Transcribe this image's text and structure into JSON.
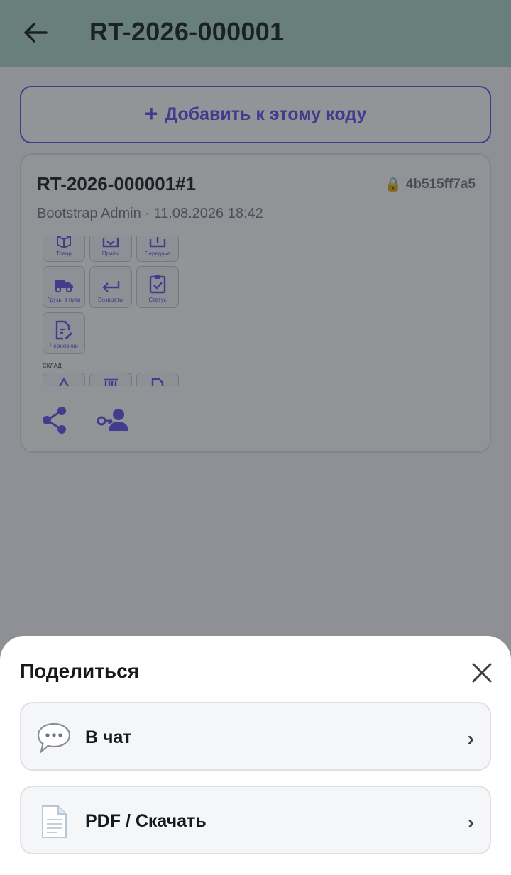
{
  "header": {
    "title": "RT-2026-000001",
    "back_icon": "arrow-left-icon"
  },
  "add_button": {
    "plus": "+",
    "label": "Добавить к этому коду"
  },
  "card": {
    "title": "RT-2026-000001#1",
    "lock_icon": "🔒",
    "hash": "4b515ff7a5",
    "meta": "Bootstrap Admin · 11.08.2026 18:42",
    "thumbnail": {
      "tiles_row1": [
        "Товар",
        "Приём",
        "Передача"
      ],
      "tiles_row2": [
        "Грузы в пути",
        "Возвраты",
        "Статус"
      ],
      "tiles_row3": [
        "Черновики"
      ],
      "section_label": "СКЛАД"
    },
    "actions": [
      "share-icon",
      "access-key-person-icon"
    ]
  },
  "sheet": {
    "title": "Поделиться",
    "close_icon": "close-icon",
    "options": [
      {
        "icon": "speech-bubble-icon",
        "label": "В чат",
        "chevron": "›"
      },
      {
        "icon": "document-icon",
        "label": "PDF / Скачать",
        "chevron": "›"
      }
    ]
  },
  "colors": {
    "accent": "#5b4ee6",
    "topbar": "#a9d4c8",
    "overlay": "rgba(40,42,48,0.5)"
  }
}
